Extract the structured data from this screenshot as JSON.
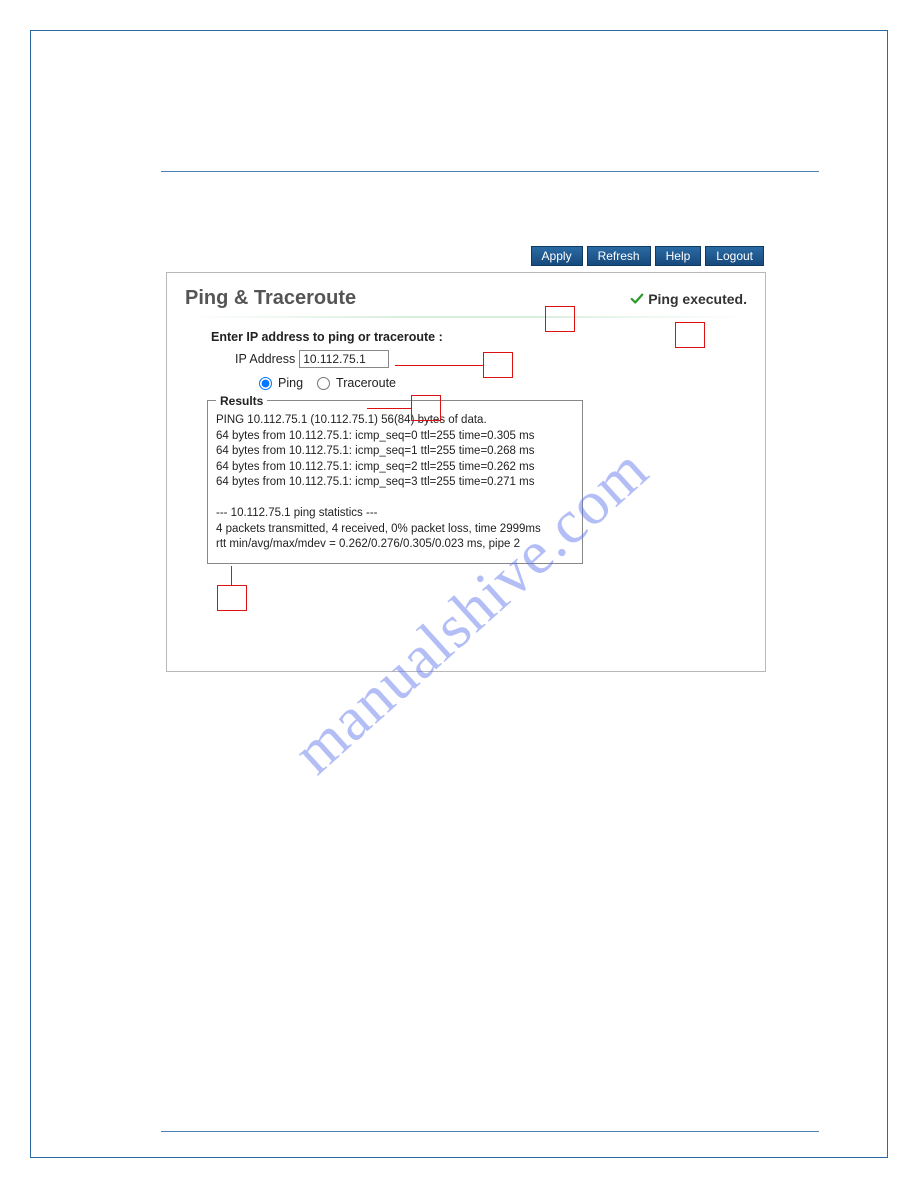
{
  "toolbar": {
    "apply": "Apply",
    "refresh": "Refresh",
    "help": "Help",
    "logout": "Logout"
  },
  "panel": {
    "title": "Ping & Traceroute",
    "status": "Ping executed."
  },
  "form": {
    "prompt": "Enter IP address to ping or traceroute :",
    "ip_label": "IP Address",
    "ip_value": "10.112.75.1",
    "radio_ping": "Ping",
    "radio_traceroute": "Traceroute"
  },
  "results": {
    "legend": "Results",
    "text": "PING 10.112.75.1 (10.112.75.1) 56(84) bytes of data.\n64 bytes from 10.112.75.1: icmp_seq=0 ttl=255 time=0.305 ms\n64 bytes from 10.112.75.1: icmp_seq=1 ttl=255 time=0.268 ms\n64 bytes from 10.112.75.1: icmp_seq=2 ttl=255 time=0.262 ms\n64 bytes from 10.112.75.1: icmp_seq=3 ttl=255 time=0.271 ms\n\n--- 10.112.75.1 ping statistics ---\n4 packets transmitted, 4 received, 0% packet loss, time 2999ms\nrtt min/avg/max/mdev = 0.262/0.276/0.305/0.023 ms, pipe 2"
  },
  "watermark": "manualshive.com"
}
